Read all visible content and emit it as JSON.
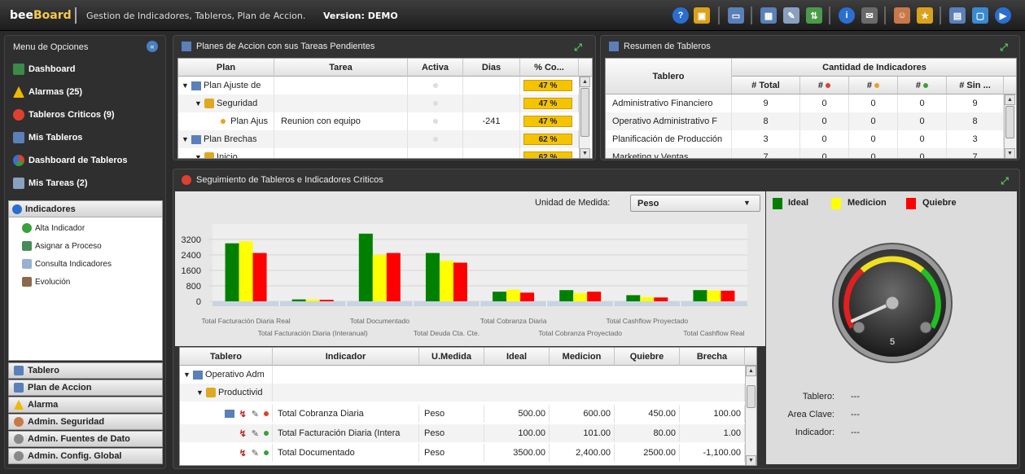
{
  "app": {
    "logo_a": "bee",
    "logo_b": "Board",
    "title": "Gestion de Indicadores, Tableros, Plan de Accion.",
    "version": "Version: DEMO"
  },
  "toolbar": {
    "icons": [
      "help-icon",
      "lock-icon",
      "window-icon",
      "grid-icon",
      "edit-icon",
      "transfer-icon",
      "info-icon",
      "mail-icon",
      "user-icon",
      "star-icon",
      "layout-icon",
      "monitor-icon",
      "next-icon"
    ]
  },
  "sidemenu": {
    "title": "Menu de Opciones",
    "items": [
      {
        "label": "Dashboard",
        "icon": "table-icon"
      },
      {
        "label": "Alarmas (25)",
        "icon": "warning-icon"
      },
      {
        "label": "Tableros Criticos (9)",
        "icon": "critical-icon"
      },
      {
        "label": "Mis Tableros",
        "icon": "boards-icon"
      },
      {
        "label": "Dashboard de Tableros",
        "icon": "pie-chart-icon"
      },
      {
        "label": "Mis Tareas (2)",
        "icon": "tasks-icon"
      }
    ],
    "indicadores": {
      "title": "Indicadores",
      "items": [
        {
          "label": "Alta Indicador",
          "icon": "add-icon"
        },
        {
          "label": "Asignar a Proceso",
          "icon": "assign-icon"
        },
        {
          "label": "Consulta Indicadores",
          "icon": "query-icon"
        },
        {
          "label": "Evolución",
          "icon": "evolution-icon"
        }
      ]
    },
    "sections": [
      {
        "label": "Tablero",
        "icon": "table-icon"
      },
      {
        "label": "Plan de Accion",
        "icon": "plan-icon"
      },
      {
        "label": "Alarma",
        "icon": "warning-icon"
      },
      {
        "label": "Admin. Seguridad",
        "icon": "user-icon"
      },
      {
        "label": "Admin. Fuentes de Dato",
        "icon": "gear-icon"
      },
      {
        "label": "Admin. Config. Global",
        "icon": "gear-icon"
      }
    ]
  },
  "planes": {
    "title": "Planes de Accion con sus Tareas Pendientes",
    "headers": [
      "Plan",
      "Tarea",
      "Activa",
      "Dias",
      "% Co..."
    ],
    "rows": [
      {
        "plan": "Plan Ajuste de",
        "tarea": "",
        "dias": "",
        "pct": "47 %"
      },
      {
        "plan": "Seguridad",
        "tarea": "",
        "dias": "",
        "pct": "47 %"
      },
      {
        "plan": "Plan Ajus",
        "tarea": "Reunion con equipo",
        "dias": "-241",
        "pct": "47 %"
      },
      {
        "plan": "Plan Brechas",
        "tarea": "",
        "dias": "",
        "pct": "62 %"
      },
      {
        "plan": "Inicio",
        "tarea": "",
        "dias": "",
        "pct": "62 %"
      }
    ]
  },
  "resumen": {
    "title": "Resumen de Tableros",
    "headers": {
      "tablero": "Tablero",
      "group": "Cantidad de Indicadores",
      "total": "# Total",
      "red": "#",
      "yellow": "#",
      "green": "#",
      "sin": "# Sin ..."
    },
    "rows": [
      {
        "tablero": "Administrativo Financiero",
        "total": "9",
        "red": "0",
        "yellow": "0",
        "green": "0",
        "sin": "9"
      },
      {
        "tablero": "Operativo Administrativo F",
        "total": "8",
        "red": "0",
        "yellow": "0",
        "green": "0",
        "sin": "8"
      },
      {
        "tablero": "Planificación de Producción",
        "total": "3",
        "red": "0",
        "yellow": "0",
        "green": "0",
        "sin": "3"
      },
      {
        "tablero": "Marketing y Ventas",
        "total": "7",
        "red": "0",
        "yellow": "0",
        "green": "0",
        "sin": "7"
      }
    ]
  },
  "seguimiento": {
    "title": "Seguimiento de Tableros e Indicadores Criticos",
    "unidad_label": "Unidad de Medida:",
    "unidad_value": "Peso",
    "legend": [
      {
        "label": "Ideal",
        "color": "#008000"
      },
      {
        "label": "Medicion",
        "color": "#ffff00"
      },
      {
        "label": "Quiebre",
        "color": "#ff0000"
      }
    ],
    "table": {
      "headers": [
        "Tablero",
        "Indicador",
        "U.Medida",
        "Ideal",
        "Medicion",
        "Quiebre",
        "Brecha"
      ],
      "tree": [
        {
          "label": "Operativo Adm"
        },
        {
          "label": "Productivid"
        }
      ],
      "rows": [
        {
          "indicador": "Total Cobranza Diaria",
          "umedida": "Peso",
          "ideal": "500.00",
          "medicion": "600.00",
          "quiebre": "450.00",
          "brecha": "100.00"
        },
        {
          "indicador": "Total Facturación Diaria (Intera",
          "umedida": "Peso",
          "ideal": "100.00",
          "medicion": "101.00",
          "quiebre": "80.00",
          "brecha": "1.00"
        },
        {
          "indicador": "Total Documentado",
          "umedida": "Peso",
          "ideal": "3500.00",
          "medicion": "2,400.00",
          "quiebre": "2500.00",
          "brecha": "-1,100.00"
        }
      ]
    },
    "gauge": {
      "value": "5"
    },
    "info": {
      "tablero_label": "Tablero:",
      "tablero_value": "---",
      "area_label": "Area Clave:",
      "area_value": "---",
      "indicador_label": "Indicador:",
      "indicador_value": "---"
    }
  },
  "chart_data": {
    "type": "bar",
    "categories": [
      "Total Facturación Diaria Real",
      "Total Facturación Diaria (Interanual)",
      "Total Documentado",
      "Total Deuda Cta. Cte.",
      "Total Cobranza Diaria",
      "Total Cobranza Proyectado",
      "Total Cashflow Proyectado",
      "Total Cashflow Real"
    ],
    "series": [
      {
        "name": "Ideal",
        "color": "#008000",
        "values": [
          3000,
          100,
          3500,
          2500,
          500,
          580,
          320,
          580
        ]
      },
      {
        "name": "Medicion",
        "color": "#ffff00",
        "values": [
          3100,
          101,
          2400,
          2100,
          600,
          420,
          220,
          560
        ]
      },
      {
        "name": "Quiebre",
        "color": "#ff0000",
        "values": [
          2500,
          80,
          2500,
          2000,
          450,
          500,
          200,
          550
        ]
      }
    ],
    "ytick_labels": [
      "0",
      "800",
      "1600",
      "2400",
      "3200"
    ],
    "ylim": [
      0,
      4000
    ]
  }
}
